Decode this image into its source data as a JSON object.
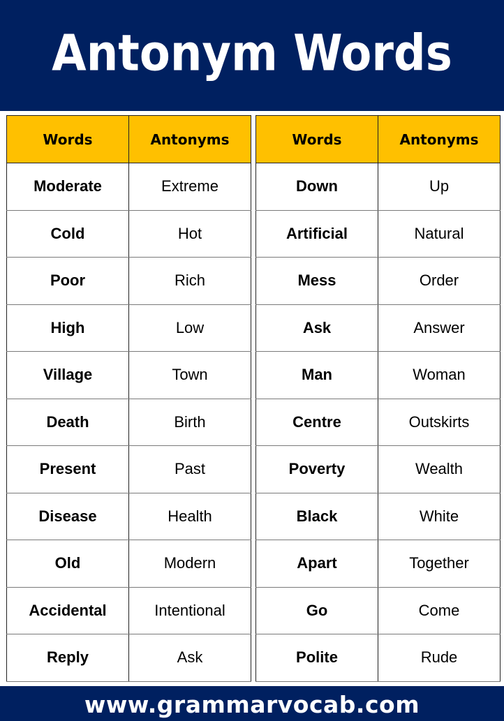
{
  "title": "Antonym Words",
  "colors": {
    "navy": "#002060",
    "header_row": "#FFC000",
    "text": "#000000",
    "title_text": "#FFFFFF"
  },
  "tables": [
    {
      "headers": [
        "Words",
        "Antonyms"
      ],
      "rows": [
        {
          "word": "Moderate",
          "antonym": "Extreme"
        },
        {
          "word": "Cold",
          "antonym": "Hot"
        },
        {
          "word": "Poor",
          "antonym": "Rich"
        },
        {
          "word": "High",
          "antonym": "Low"
        },
        {
          "word": "Village",
          "antonym": "Town"
        },
        {
          "word": "Death",
          "antonym": "Birth"
        },
        {
          "word": "Present",
          "antonym": "Past"
        },
        {
          "word": "Disease",
          "antonym": "Health"
        },
        {
          "word": "Old",
          "antonym": "Modern"
        },
        {
          "word": "Accidental",
          "antonym": "Intentional"
        },
        {
          "word": "Reply",
          "antonym": "Ask"
        }
      ]
    },
    {
      "headers": [
        "Words",
        "Antonyms"
      ],
      "rows": [
        {
          "word": "Down",
          "antonym": "Up"
        },
        {
          "word": "Artificial",
          "antonym": "Natural"
        },
        {
          "word": "Mess",
          "antonym": "Order"
        },
        {
          "word": "Ask",
          "antonym": "Answer"
        },
        {
          "word": "Man",
          "antonym": "Woman"
        },
        {
          "word": "Centre",
          "antonym": "Outskirts"
        },
        {
          "word": "Poverty",
          "antonym": "Wealth"
        },
        {
          "word": "Black",
          "antonym": "White"
        },
        {
          "word": "Apart",
          "antonym": "Together"
        },
        {
          "word": "Go",
          "antonym": "Come"
        },
        {
          "word": "Polite",
          "antonym": "Rude"
        }
      ]
    }
  ],
  "footer": {
    "url": "www.grammarvocab.com"
  }
}
